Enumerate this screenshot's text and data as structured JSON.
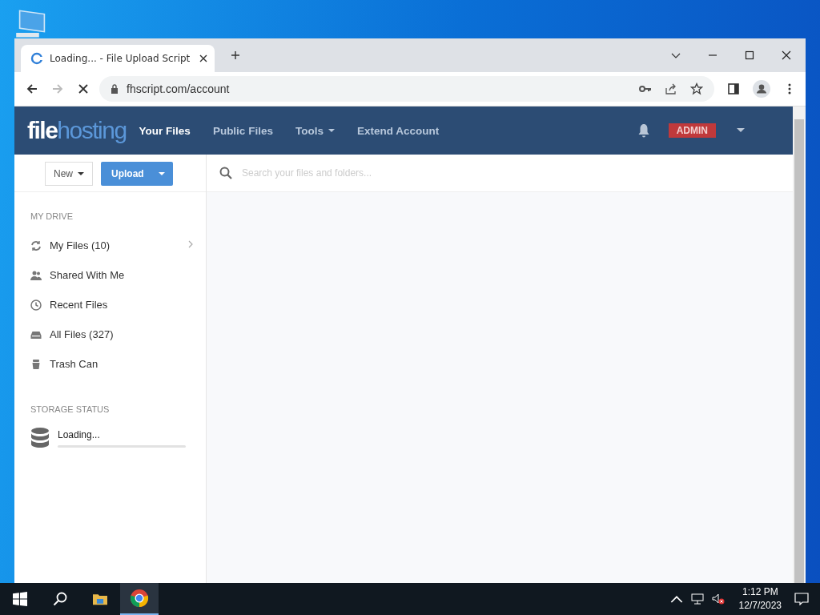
{
  "browser": {
    "tab_title": "Loading... - File Upload Script",
    "address": "fhscript.com/account"
  },
  "site": {
    "logo": [
      "file",
      "hosting"
    ],
    "nav": [
      {
        "label": "Your Files",
        "selected": true,
        "dropdown": false
      },
      {
        "label": "Public Files",
        "selected": false,
        "dropdown": false
      },
      {
        "label": "Tools",
        "selected": false,
        "dropdown": true
      },
      {
        "label": "Extend Account",
        "selected": false,
        "dropdown": false
      }
    ],
    "user_badge": "ADMIN"
  },
  "toolbar": {
    "new_button": "New",
    "upload_button": "Upload"
  },
  "search": {
    "placeholder": "Search your files and folders..."
  },
  "sidebar": {
    "heading": "MY DRIVE",
    "items": [
      {
        "kind": "sync",
        "label": "My Files (10)",
        "expandable": true
      },
      {
        "kind": "shared",
        "label": "Shared With Me",
        "expandable": false
      },
      {
        "kind": "recent",
        "label": "Recent Files",
        "expandable": false
      },
      {
        "kind": "all",
        "label": "All Files (327)",
        "expandable": false
      },
      {
        "kind": "trash",
        "label": "Trash Can",
        "expandable": false
      }
    ]
  },
  "storage": {
    "heading": "STORAGE STATUS",
    "text": "Loading...",
    "level": 0
  },
  "taskbar": {
    "time": "1:12 PM",
    "date": "12/7/2023"
  }
}
